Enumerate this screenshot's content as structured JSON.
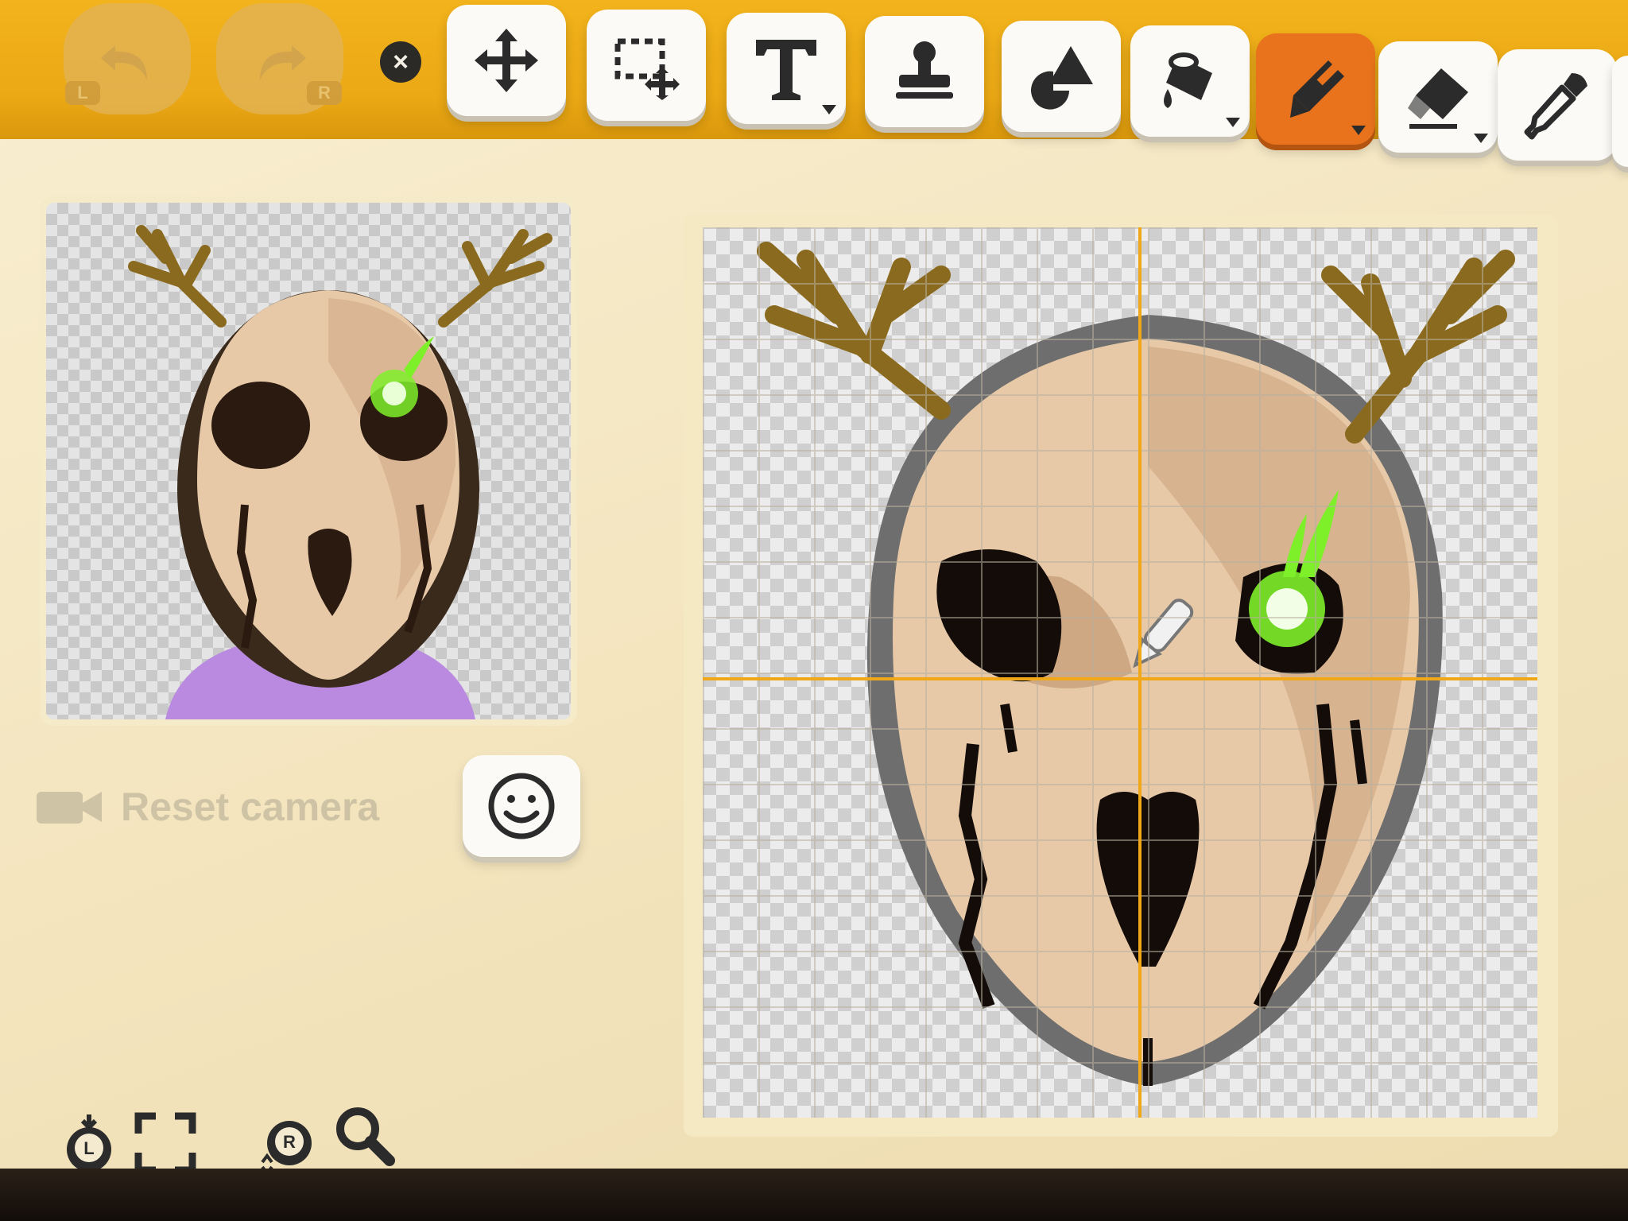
{
  "toolbar": {
    "undo": {
      "icon": "undo-icon",
      "badge": "L"
    },
    "redo": {
      "icon": "redo-icon",
      "badge": "R"
    },
    "close": {
      "icon": "close-icon",
      "label": "×"
    },
    "tools": [
      {
        "id": "move",
        "icon": "move-icon",
        "active": false
      },
      {
        "id": "select",
        "icon": "select-move-icon",
        "active": false
      },
      {
        "id": "text",
        "icon": "text-icon",
        "active": false,
        "has_submenu": true
      },
      {
        "id": "stamp",
        "icon": "stamp-icon",
        "active": false
      },
      {
        "id": "shapes",
        "icon": "shapes-icon",
        "active": false
      },
      {
        "id": "fill",
        "icon": "fill-bucket-icon",
        "active": false,
        "has_submenu": true
      },
      {
        "id": "pen",
        "icon": "pen-icon",
        "active": true,
        "has_submenu": true
      },
      {
        "id": "eraser",
        "icon": "eraser-icon",
        "active": false,
        "has_submenu": true
      },
      {
        "id": "eyedropper",
        "icon": "eyedropper-icon",
        "active": false
      }
    ],
    "accent_color": "#eba915",
    "active_color": "#e8731c"
  },
  "preview": {
    "reset_camera_label": "Reset camera",
    "face_button_icon": "smiley-icon"
  },
  "bottom_controls": {
    "left_stick_badge": "L",
    "right_stick_badge": "R",
    "icons": [
      "left-stick-icon",
      "fit-frame-icon",
      "right-stick-icon",
      "zoom-icon"
    ]
  },
  "colors": {
    "skull": "#e7c9a8",
    "antler": "#8a6a1e",
    "glow": "#7ef02a",
    "shirt": "#b98ae0"
  }
}
